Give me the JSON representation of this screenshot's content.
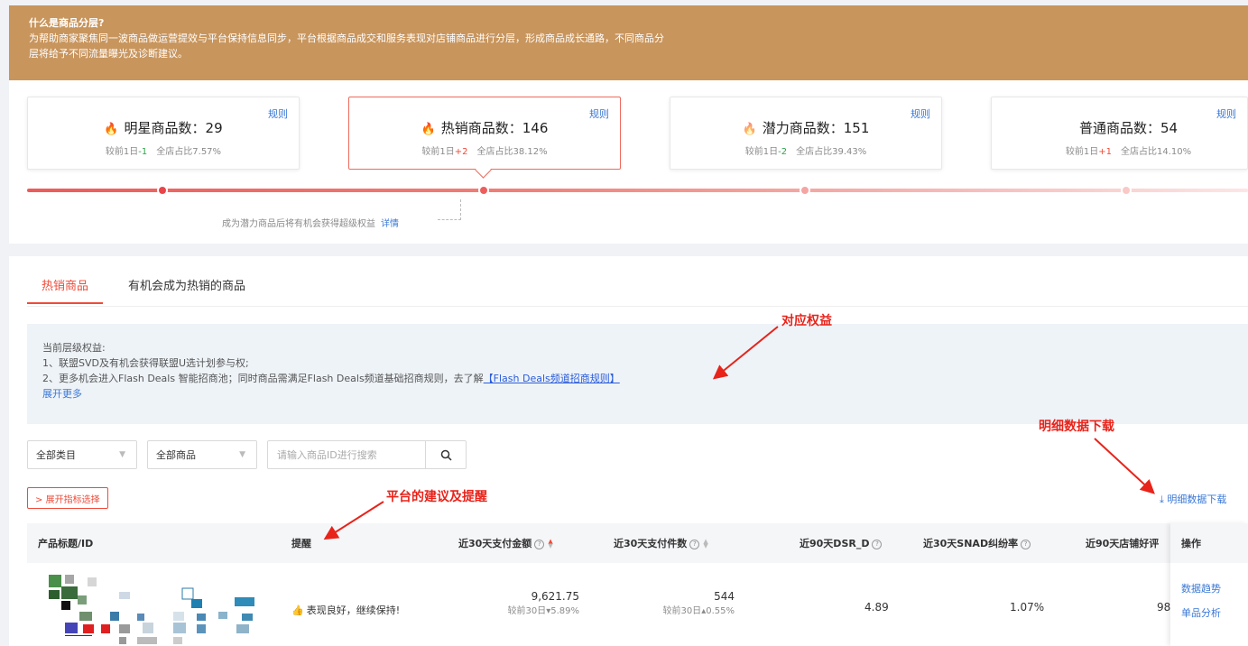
{
  "banner": {
    "title": "什么是商品分层?",
    "line1": "为帮助商家聚焦同一波商品做运营提效与平台保持信息同步，平台根据商品成交和服务表现对店铺商品进行分层，形成商品成长通路，不同商品分",
    "line2": "层将给予不同流量曝光及诊断建议。"
  },
  "tiers": [
    {
      "label": "明星商品数：29",
      "rule": "规则",
      "change_prefix": "较前1日",
      "change": "-1",
      "share": "全店占比7.57%",
      "fire": "🔥"
    },
    {
      "label": "热销商品数：146",
      "rule": "规则",
      "change_prefix": "较前1日",
      "change": "+2",
      "share": "全店占比38.12%",
      "fire": "🔥"
    },
    {
      "label": "潜力商品数：151",
      "rule": "规则",
      "change_prefix": "较前1日",
      "change": "-2",
      "share": "全店占比39.43%",
      "fire": "🔥"
    },
    {
      "label": "普通商品数：54",
      "rule": "规则",
      "change_prefix": "较前1日",
      "change": "+1",
      "share": "全店占比14.10%"
    }
  ],
  "hint": {
    "text": "成为潜力商品后将有机会获得超级权益",
    "link": "详情"
  },
  "tabs": [
    "热销商品",
    "有机会成为热销的商品"
  ],
  "benefit": {
    "title": "当前层级权益:",
    "item1": "1、联盟SVD及有机会获得联盟U选计划参与权;",
    "item2": "2、更多机会进入Flash Deals 智能招商池；同时商品需满足Flash Deals频道基础招商规则，去了解",
    "item2_link": "【Flash Deals频道招商规则】",
    "expand": "展开更多"
  },
  "annotations": {
    "benefit": "对应权益",
    "download": "明细数据下载",
    "advice": "平台的建议及提醒"
  },
  "filters": {
    "category": "全部类目",
    "goods": "全部商品",
    "search_placeholder": "请输入商品ID进行搜索"
  },
  "expand_button": "展开指标选择",
  "download_link": "明细数据下载",
  "table": {
    "headers": {
      "product": "产品标题/ID",
      "reminder": "提醒",
      "pay_amount": "近30天支付金额",
      "pay_count": "近30天支付件数",
      "dsr": "近90天DSR_D",
      "snad": "近30天SNAD纠纷率",
      "store_rating": "近90天店铺好评",
      "ops": "操作"
    },
    "row": {
      "reminder": "表现良好，继续保持!",
      "pay_amount": "9,621.75",
      "pay_amount_change": "较前30日",
      "pay_amount_pct": "5.89%",
      "pay_count": "544",
      "pay_count_change": "较前30日",
      "pay_count_pct": "0.55%",
      "dsr": "4.89",
      "snad": "1.07%",
      "store_rating": "98"
    },
    "ops": [
      "数据趋势",
      "单品分析"
    ]
  },
  "colors": {
    "banner": "#c8955d",
    "accent": "#ee4b3a",
    "link": "#3a78d6",
    "annotation": "#e8231a"
  }
}
